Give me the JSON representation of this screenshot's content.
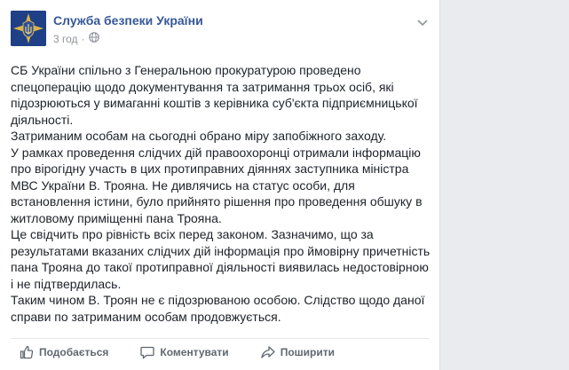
{
  "post": {
    "page_name": "Служба безпеки України",
    "time": "3 год",
    "dot": "·",
    "paragraphs": [
      "СБ України спільно з Генеральною прокуратурою проведено",
      "спецоперацію щодо документування та затримання трьох осіб, які",
      "підозрюються у вимаганні коштів з керівника суб'єкта підприємницької",
      "діяльності.",
      "Затриманим особам на сьогодні обрано міру запобіжного заходу.",
      "У рамках проведення слідчих дій правоохоронці отримали інформацію",
      "про вірогідну участь в цих протиправних діяннях заступника міністра",
      "МВС України В. Трояна. Не дивлячись на статус особи, для",
      "встановлення істини, було прийнято рішення про проведення обшуку в",
      "житловому приміщенні пана Трояна.",
      "Це свідчить про рівність всіх перед законом. Зазначимо, що за",
      "результатами вказаних слідчих дій інформація про ймовірну причетність",
      "пана Трояна до такої протиправної діяльності виявилась недостовірною",
      "і не підтвердилась.",
      "Таким чином В. Троян не є підозрюваною особою. Слідство щодо даної",
      "справи по затриманим особам продовжується."
    ]
  },
  "actions": {
    "like": "Подобається",
    "comment": "Коментувати",
    "share": "Поширити"
  },
  "icons": {
    "avatar": "sbu-emblem-icon",
    "audience": "globe-icon",
    "menu": "chevron-down-icon",
    "like": "thumbs-up-icon",
    "comment": "comment-bubble-icon",
    "share": "share-arrow-icon"
  },
  "colors": {
    "link": "#365899",
    "text": "#1d2129",
    "meta": "#90949c",
    "action": "#606770",
    "avatar_bg": "#1f3f86"
  }
}
